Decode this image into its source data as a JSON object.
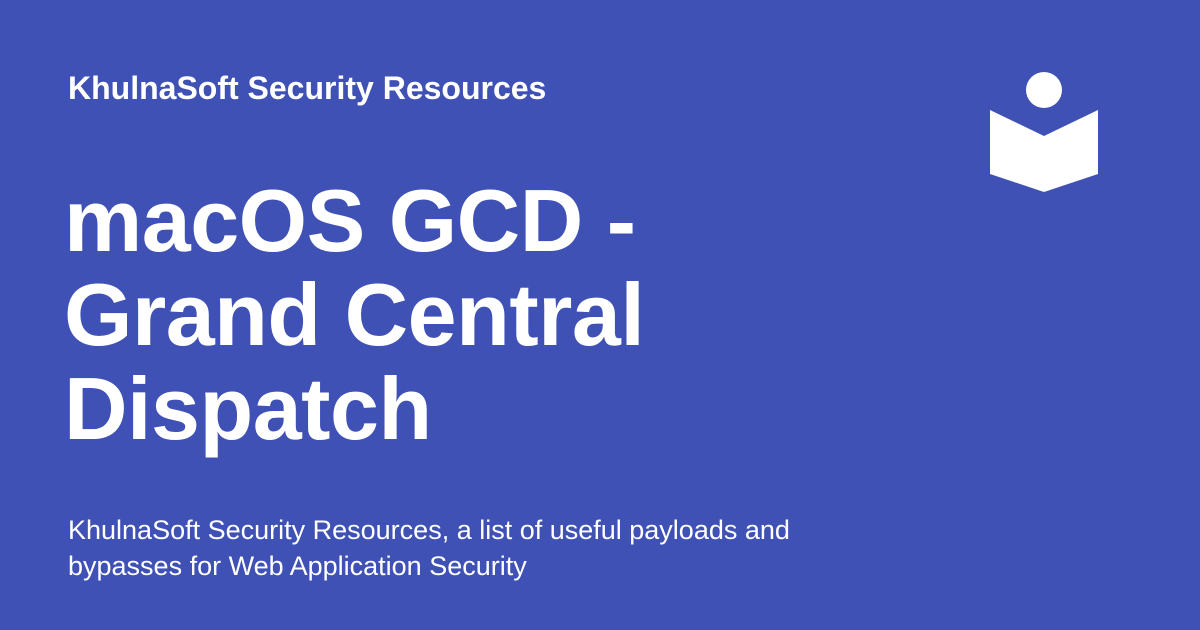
{
  "site_name": "KhulnaSoft Security Resources",
  "title_lines": [
    "macOS GCD -",
    "Grand Central",
    "Dispatch"
  ],
  "description": "KhulnaSoft Security Resources, a list of useful payloads and bypasses for Web Application Security",
  "logo_icon": "reading-book-icon",
  "colors": {
    "background": "#3f51b5",
    "text": "#ffffff"
  }
}
